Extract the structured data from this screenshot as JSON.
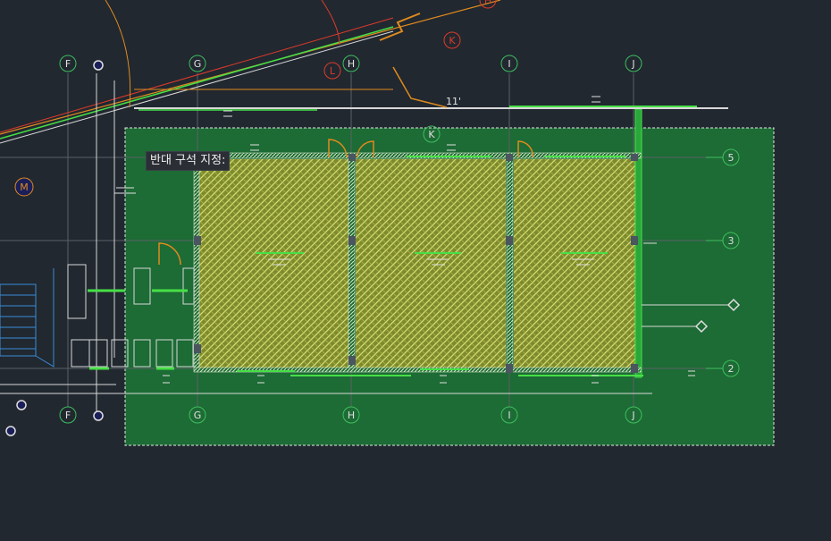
{
  "prompt": {
    "text": "반대 구석 지정:"
  },
  "grid_labels_top": [
    "F",
    "G",
    "H",
    "I",
    "J"
  ],
  "grid_labels_bottom": [
    "F",
    "G",
    "H",
    "I",
    "J"
  ],
  "row_labels": [
    "5",
    "3",
    "2"
  ],
  "red_labels": [
    "K",
    "L",
    "H"
  ],
  "green_labels": [
    "K"
  ],
  "orange_labels": [
    "M"
  ],
  "dimension_text": "11'",
  "colors": {
    "background": "#212830",
    "selection_fill": "#1d6b35",
    "hatch": "#b8c25a",
    "wall": "#46e046",
    "grid_circle": "#3fbf5f",
    "red_line": "#e03a2a",
    "orange_line": "#e08a1e"
  }
}
